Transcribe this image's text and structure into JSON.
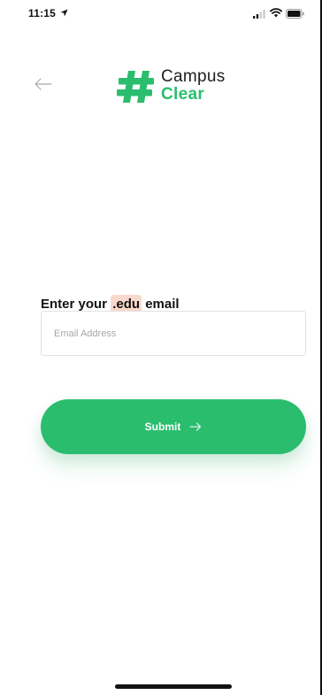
{
  "status_bar": {
    "time": "11:15",
    "icons": [
      "location-arrow-icon",
      "signal-icon",
      "wifi-icon",
      "battery-icon"
    ]
  },
  "header": {
    "back_icon": "arrow-left-icon",
    "logo": {
      "symbol": "#",
      "line1": "Campus",
      "line2": "Clear"
    }
  },
  "form": {
    "heading_prefix": "Enter your ",
    "heading_highlight": ".edu",
    "heading_suffix": " email",
    "email_placeholder": "Email Address",
    "email_value": "",
    "submit_label": "Submit",
    "submit_icon": "arrow-right-icon"
  },
  "colors": {
    "brand_green": "#2bbd6e",
    "highlight": "#f8d9cb",
    "text": "#111111",
    "placeholder": "#a7a7a7"
  }
}
